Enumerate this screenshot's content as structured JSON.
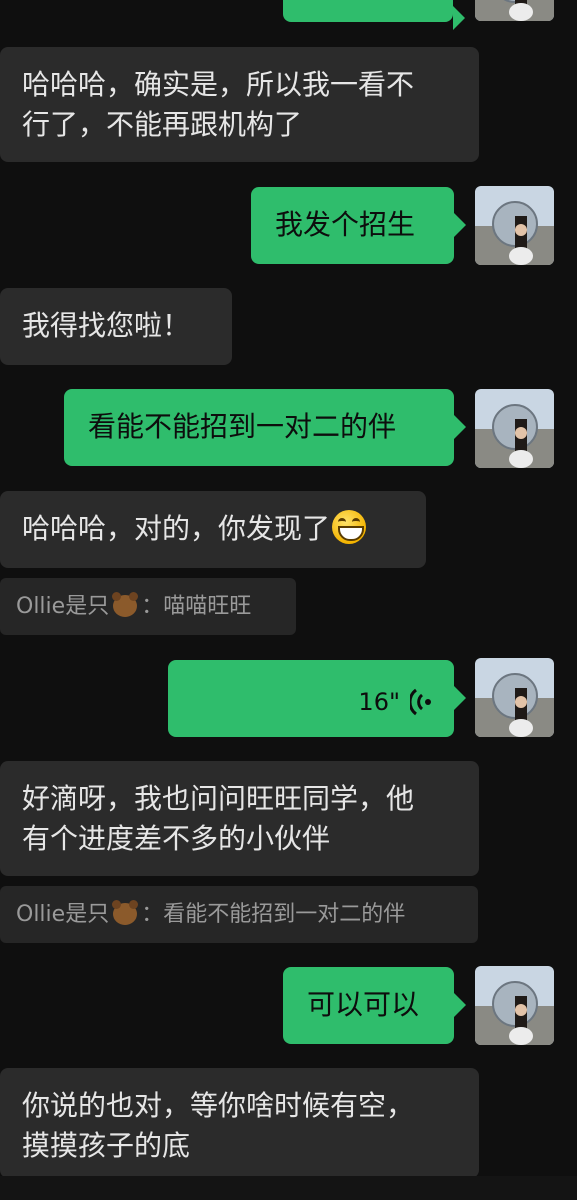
{
  "messages": {
    "m0": {
      "side": "out"
    },
    "m1": {
      "line1": "哈哈哈，确实是，所以我一看不",
      "line2": "行了，不能再跟机构了"
    },
    "m2": {
      "text": "我发个招生"
    },
    "m3": {
      "text": "我得找您啦！"
    },
    "m4": {
      "text": "看能不能招到一对二的伴"
    },
    "m5": {
      "text": "哈哈哈，对的，你发现了",
      "emoji": "grinning-face-icon"
    },
    "q1": {
      "prefix": "Ollie是只",
      "icon": "bear-icon",
      "text": "：喵喵旺旺"
    },
    "m6": {
      "duration": "16\"",
      "icon": "voice-wave-icon"
    },
    "m7": {
      "line1": "好滴呀，我也问问旺旺同学，他",
      "line2": "有个进度差不多的小伙伴"
    },
    "q2": {
      "prefix": "Ollie是只",
      "icon": "bear-icon",
      "text": "：看能不能招到一对二的伴"
    },
    "m8": {
      "text": "可以可以"
    },
    "m9": {
      "line1": "你说的也对，等你啥时候有空，",
      "line2": "摸摸孩子的底"
    }
  },
  "colors": {
    "outgoing": "#2fbd6c",
    "incoming": "#2b2b2b",
    "background": "#0f0f0f"
  }
}
